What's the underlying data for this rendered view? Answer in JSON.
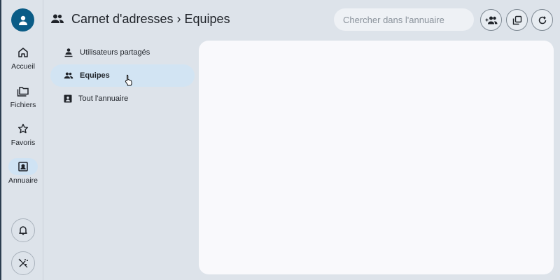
{
  "rail": {
    "items": [
      {
        "label": "Accueil",
        "icon": "home-icon",
        "active": false
      },
      {
        "label": "Fichiers",
        "icon": "folders-icon",
        "active": false
      },
      {
        "label": "Favoris",
        "icon": "star-icon",
        "active": false
      },
      {
        "label": "Annuaire",
        "icon": "contact-card-icon",
        "active": true
      }
    ],
    "bottom": [
      "bell-icon",
      "magic-wand-icon"
    ]
  },
  "header": {
    "breadcrumb": [
      "Carnet d'adresses",
      "Equipes"
    ],
    "separator": "›",
    "search_placeholder": "Chercher dans l'annuaire",
    "actions": [
      "add-group-icon",
      "copy-icon",
      "refresh-icon"
    ]
  },
  "secondary_nav": {
    "items": [
      {
        "label": "Utilisateurs partagés",
        "icon": "shared-user-icon",
        "active": false
      },
      {
        "label": "Equipes",
        "icon": "group-icon",
        "active": true
      },
      {
        "label": "Tout l'annuaire",
        "icon": "contact-card-icon",
        "active": false
      }
    ]
  },
  "colors": {
    "background": "#dde3ea",
    "avatar": "#0b5c86",
    "active_item": "#d2e4f3",
    "panel": "#f9f9fc"
  }
}
